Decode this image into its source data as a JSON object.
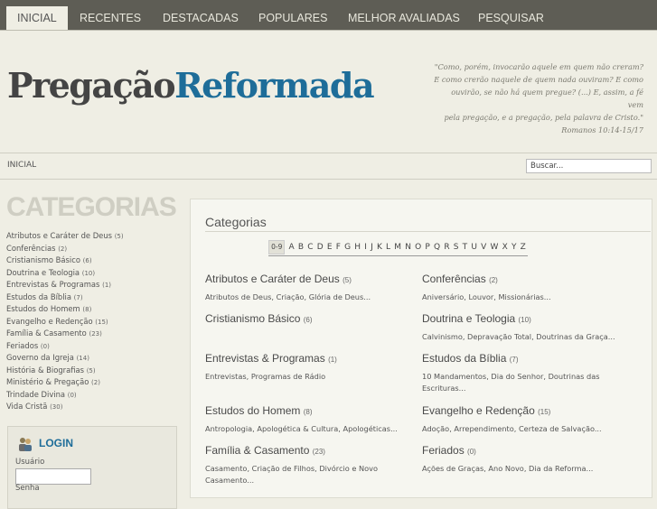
{
  "nav": {
    "tabs": [
      {
        "label": "INICIAL"
      },
      {
        "label": "RECENTES"
      },
      {
        "label": "DESTACADAS"
      },
      {
        "label": "POPULARES"
      },
      {
        "label": "MELHOR AVALIADAS"
      },
      {
        "label": "PESQUISAR"
      }
    ]
  },
  "logo": {
    "part1": "Pregação",
    "part2": "Reformada"
  },
  "quote": {
    "lines": [
      "\"Como, porém, invocarão aquele em quem não creram?",
      "E como crerão naquele de quem nada ouviram? E como",
      "ouvirão, se não há quem pregue? (...) E, assim, a fé vem",
      "pela pregação, e a pregação, pela palavra de Cristo.\""
    ],
    "ref": "Romanos 10:14-15/17"
  },
  "breadcrumb": {
    "label": "INICIAL"
  },
  "search": {
    "value": "Buscar..."
  },
  "sidebar": {
    "title": "CATEGORIAS",
    "items": [
      {
        "label": "Atributos e Caráter de Deus",
        "count": "(5)"
      },
      {
        "label": "Conferências",
        "count": "(2)"
      },
      {
        "label": "Cristianismo Básico",
        "count": "(6)"
      },
      {
        "label": "Doutrina e Teologia",
        "count": "(10)"
      },
      {
        "label": "Entrevistas & Programas",
        "count": "(1)"
      },
      {
        "label": "Estudos da Bíblia",
        "count": "(7)"
      },
      {
        "label": "Estudos do Homem",
        "count": "(8)"
      },
      {
        "label": "Evangelho e Redenção",
        "count": "(15)"
      },
      {
        "label": "Família & Casamento",
        "count": "(23)"
      },
      {
        "label": "Feriados",
        "count": "(0)"
      },
      {
        "label": "Governo da Igreja",
        "count": "(14)"
      },
      {
        "label": "História & Biografias",
        "count": "(5)"
      },
      {
        "label": "Ministério & Pregação",
        "count": "(2)"
      },
      {
        "label": "Trindade Divina",
        "count": "(0)"
      },
      {
        "label": "Vida Cristã",
        "count": "(30)"
      }
    ]
  },
  "login": {
    "title": "LOGIN",
    "user_label": "Usuário",
    "pass_label": "Senha"
  },
  "main": {
    "title": "Categorias",
    "alphabet": [
      "0-9",
      "A",
      "B",
      "C",
      "D",
      "E",
      "F",
      "G",
      "H",
      "I",
      "J",
      "K",
      "L",
      "M",
      "N",
      "O",
      "P",
      "Q",
      "R",
      "S",
      "T",
      "U",
      "V",
      "W",
      "X",
      "Y",
      "Z"
    ],
    "categories": [
      {
        "name": "Atributos e Caráter de Deus",
        "count": "(5)",
        "sub": "Atributos de Deus, Criação, Glória de Deus..."
      },
      {
        "name": "Conferências",
        "count": "(2)",
        "sub": "Aniversário, Louvor, Missionárias..."
      },
      {
        "name": "Cristianismo Básico",
        "count": "(6)",
        "sub": ""
      },
      {
        "name": "Doutrina e Teologia",
        "count": "(10)",
        "sub": "Calvinismo, Depravação Total, Doutrinas da Graça..."
      },
      {
        "name": "Entrevistas & Programas",
        "count": "(1)",
        "sub": "Entrevistas, Programas de Rádio"
      },
      {
        "name": "Estudos da Bíblia",
        "count": "(7)",
        "sub": "10 Mandamentos, Dia do Senhor, Doutrinas das Escrituras..."
      },
      {
        "name": "Estudos do Homem",
        "count": "(8)",
        "sub": "Antropologia, Apologética & Cultura, Apologéticas..."
      },
      {
        "name": "Evangelho e Redenção",
        "count": "(15)",
        "sub": "Adoção, Arrependimento, Certeza de Salvação..."
      },
      {
        "name": "Família & Casamento",
        "count": "(23)",
        "sub": "Casamento, Criação de Filhos, Divórcio e Novo Casamento..."
      },
      {
        "name": "Feriados",
        "count": "(0)",
        "sub": "Ações de Graças, Ano Novo, Dia da Reforma..."
      }
    ]
  }
}
